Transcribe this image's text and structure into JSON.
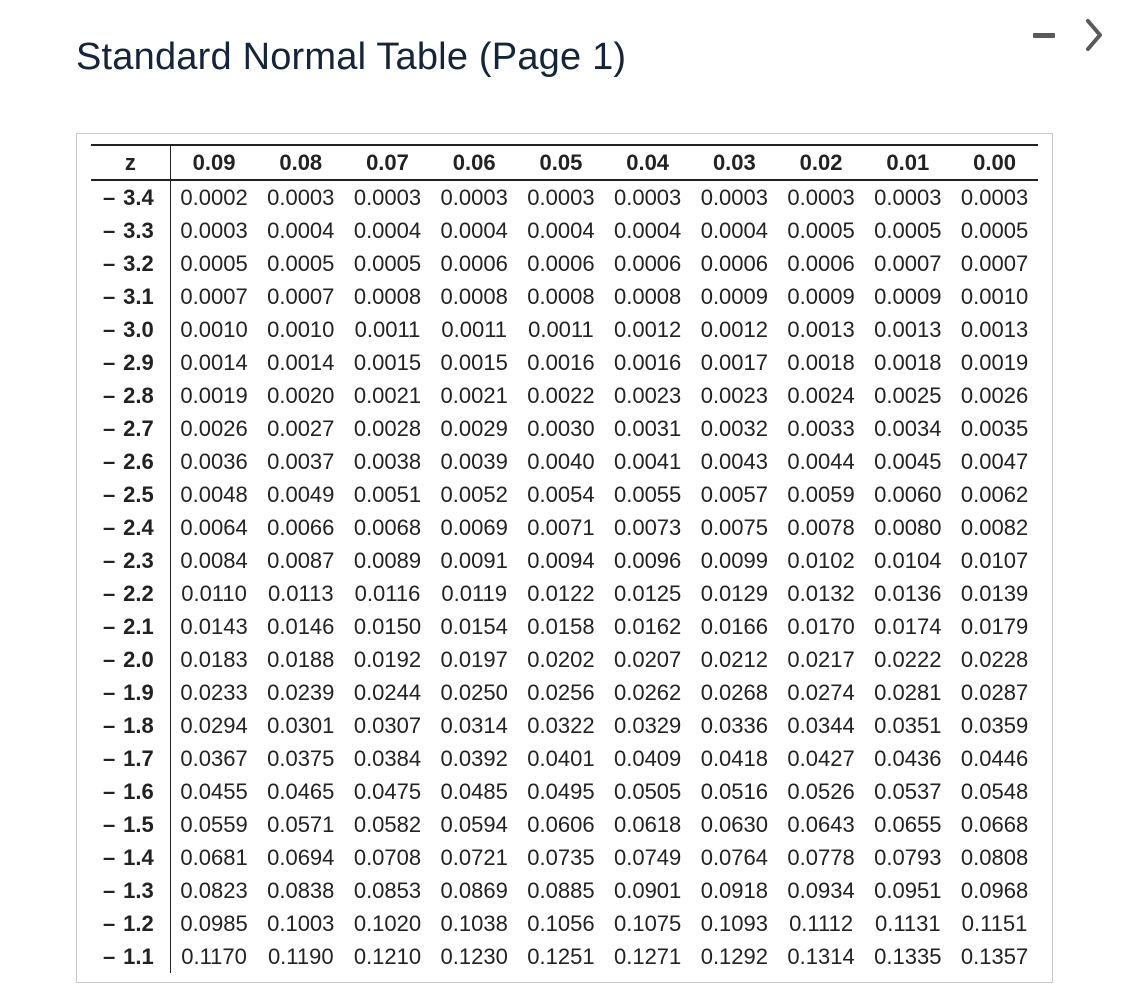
{
  "title": "Standard Normal Table (Page 1)",
  "controls": {
    "minimize": "minimize",
    "next": "next"
  },
  "table": {
    "z_header": "z",
    "col_headers": [
      "0.09",
      "0.08",
      "0.07",
      "0.06",
      "0.05",
      "0.04",
      "0.03",
      "0.02",
      "0.01",
      "0.00"
    ],
    "rows": [
      {
        "z": "3.4",
        "v": [
          "0.0002",
          "0.0003",
          "0.0003",
          "0.0003",
          "0.0003",
          "0.0003",
          "0.0003",
          "0.0003",
          "0.0003",
          "0.0003"
        ]
      },
      {
        "z": "3.3",
        "v": [
          "0.0003",
          "0.0004",
          "0.0004",
          "0.0004",
          "0.0004",
          "0.0004",
          "0.0004",
          "0.0005",
          "0.0005",
          "0.0005"
        ]
      },
      {
        "z": "3.2",
        "v": [
          "0.0005",
          "0.0005",
          "0.0005",
          "0.0006",
          "0.0006",
          "0.0006",
          "0.0006",
          "0.0006",
          "0.0007",
          "0.0007"
        ]
      },
      {
        "z": "3.1",
        "v": [
          "0.0007",
          "0.0007",
          "0.0008",
          "0.0008",
          "0.0008",
          "0.0008",
          "0.0009",
          "0.0009",
          "0.0009",
          "0.0010"
        ]
      },
      {
        "z": "3.0",
        "v": [
          "0.0010",
          "0.0010",
          "0.0011",
          "0.0011",
          "0.0011",
          "0.0012",
          "0.0012",
          "0.0013",
          "0.0013",
          "0.0013"
        ]
      },
      {
        "z": "2.9",
        "v": [
          "0.0014",
          "0.0014",
          "0.0015",
          "0.0015",
          "0.0016",
          "0.0016",
          "0.0017",
          "0.0018",
          "0.0018",
          "0.0019"
        ]
      },
      {
        "z": "2.8",
        "v": [
          "0.0019",
          "0.0020",
          "0.0021",
          "0.0021",
          "0.0022",
          "0.0023",
          "0.0023",
          "0.0024",
          "0.0025",
          "0.0026"
        ]
      },
      {
        "z": "2.7",
        "v": [
          "0.0026",
          "0.0027",
          "0.0028",
          "0.0029",
          "0.0030",
          "0.0031",
          "0.0032",
          "0.0033",
          "0.0034",
          "0.0035"
        ]
      },
      {
        "z": "2.6",
        "v": [
          "0.0036",
          "0.0037",
          "0.0038",
          "0.0039",
          "0.0040",
          "0.0041",
          "0.0043",
          "0.0044",
          "0.0045",
          "0.0047"
        ]
      },
      {
        "z": "2.5",
        "v": [
          "0.0048",
          "0.0049",
          "0.0051",
          "0.0052",
          "0.0054",
          "0.0055",
          "0.0057",
          "0.0059",
          "0.0060",
          "0.0062"
        ]
      },
      {
        "z": "2.4",
        "v": [
          "0.0064",
          "0.0066",
          "0.0068",
          "0.0069",
          "0.0071",
          "0.0073",
          "0.0075",
          "0.0078",
          "0.0080",
          "0.0082"
        ]
      },
      {
        "z": "2.3",
        "v": [
          "0.0084",
          "0.0087",
          "0.0089",
          "0.0091",
          "0.0094",
          "0.0096",
          "0.0099",
          "0.0102",
          "0.0104",
          "0.0107"
        ]
      },
      {
        "z": "2.2",
        "v": [
          "0.0110",
          "0.0113",
          "0.0116",
          "0.0119",
          "0.0122",
          "0.0125",
          "0.0129",
          "0.0132",
          "0.0136",
          "0.0139"
        ]
      },
      {
        "z": "2.1",
        "v": [
          "0.0143",
          "0.0146",
          "0.0150",
          "0.0154",
          "0.0158",
          "0.0162",
          "0.0166",
          "0.0170",
          "0.0174",
          "0.0179"
        ]
      },
      {
        "z": "2.0",
        "v": [
          "0.0183",
          "0.0188",
          "0.0192",
          "0.0197",
          "0.0202",
          "0.0207",
          "0.0212",
          "0.0217",
          "0.0222",
          "0.0228"
        ]
      },
      {
        "z": "1.9",
        "v": [
          "0.0233",
          "0.0239",
          "0.0244",
          "0.0250",
          "0.0256",
          "0.0262",
          "0.0268",
          "0.0274",
          "0.0281",
          "0.0287"
        ]
      },
      {
        "z": "1.8",
        "v": [
          "0.0294",
          "0.0301",
          "0.0307",
          "0.0314",
          "0.0322",
          "0.0329",
          "0.0336",
          "0.0344",
          "0.0351",
          "0.0359"
        ]
      },
      {
        "z": "1.7",
        "v": [
          "0.0367",
          "0.0375",
          "0.0384",
          "0.0392",
          "0.0401",
          "0.0409",
          "0.0418",
          "0.0427",
          "0.0436",
          "0.0446"
        ]
      },
      {
        "z": "1.6",
        "v": [
          "0.0455",
          "0.0465",
          "0.0475",
          "0.0485",
          "0.0495",
          "0.0505",
          "0.0516",
          "0.0526",
          "0.0537",
          "0.0548"
        ]
      },
      {
        "z": "1.5",
        "v": [
          "0.0559",
          "0.0571",
          "0.0582",
          "0.0594",
          "0.0606",
          "0.0618",
          "0.0630",
          "0.0643",
          "0.0655",
          "0.0668"
        ]
      },
      {
        "z": "1.4",
        "v": [
          "0.0681",
          "0.0694",
          "0.0708",
          "0.0721",
          "0.0735",
          "0.0749",
          "0.0764",
          "0.0778",
          "0.0793",
          "0.0808"
        ]
      },
      {
        "z": "1.3",
        "v": [
          "0.0823",
          "0.0838",
          "0.0853",
          "0.0869",
          "0.0885",
          "0.0901",
          "0.0918",
          "0.0934",
          "0.0951",
          "0.0968"
        ]
      },
      {
        "z": "1.2",
        "v": [
          "0.0985",
          "0.1003",
          "0.1020",
          "0.1038",
          "0.1056",
          "0.1075",
          "0.1093",
          "0.1112",
          "0.1131",
          "0.1151"
        ]
      },
      {
        "z": "1.1",
        "v": [
          "0.1170",
          "0.1190",
          "0.1210",
          "0.1230",
          "0.1251",
          "0.1271",
          "0.1292",
          "0.1314",
          "0.1335",
          "0.1357"
        ]
      }
    ],
    "minus_sign": "–"
  }
}
